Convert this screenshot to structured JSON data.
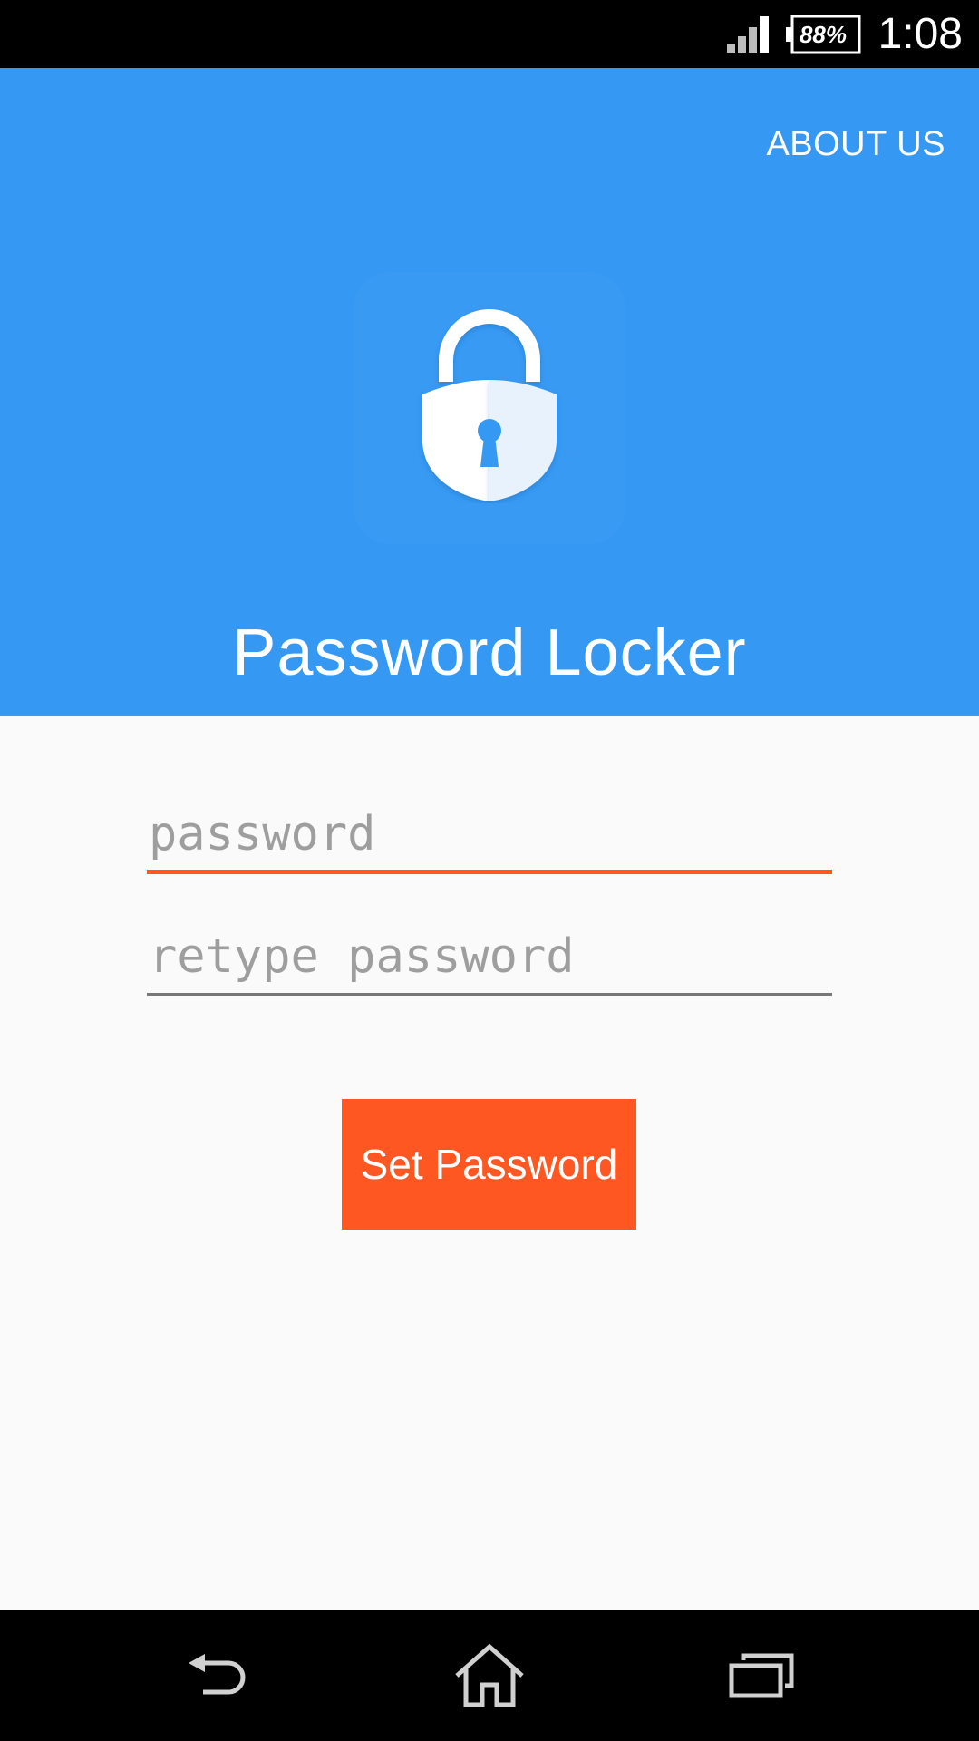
{
  "status_bar": {
    "battery": "88%",
    "time": "1:08"
  },
  "header": {
    "about_label": "ABOUT US",
    "app_title": "Password Locker",
    "background_color": "#3598f3"
  },
  "form": {
    "password_placeholder": "password",
    "retype_placeholder": "retype password",
    "submit_label": "Set Password",
    "accent_color": "#ff5722"
  },
  "icons": {
    "app_logo": "padlock-icon",
    "signal": "signal-icon",
    "battery": "battery-icon",
    "back": "back-icon",
    "home": "home-icon",
    "recents": "recents-icon"
  }
}
